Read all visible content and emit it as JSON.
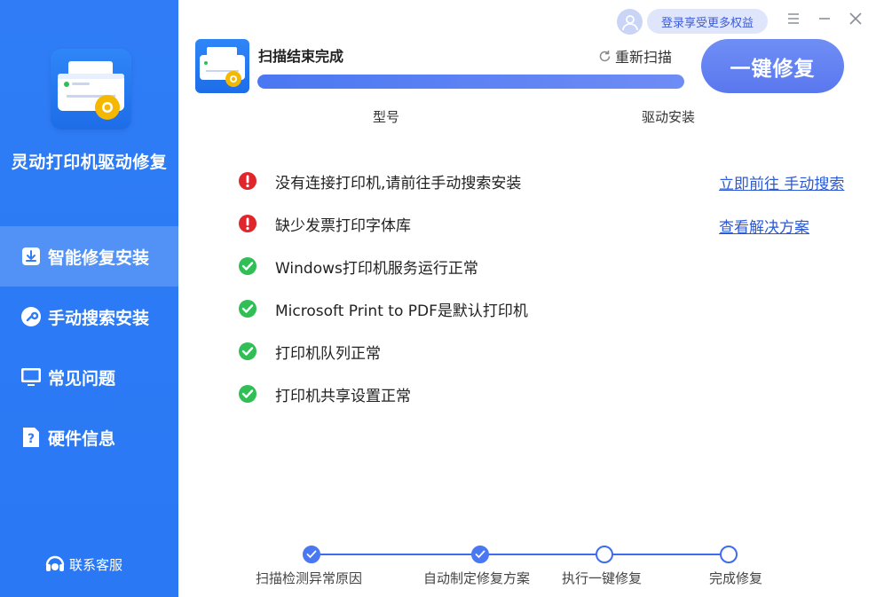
{
  "sidebar": {
    "app_title": "灵动打印机驱动修复",
    "items": [
      {
        "label": "智能修复安装",
        "icon": "download-icon",
        "active": true
      },
      {
        "label": "手动搜索安装",
        "icon": "wrench-icon",
        "active": false
      },
      {
        "label": "常见问题",
        "icon": "monitor-icon",
        "active": false
      },
      {
        "label": "硬件信息",
        "icon": "question-icon",
        "active": false
      }
    ],
    "support_label": "联系客服"
  },
  "topbar": {
    "login_label": "登录享受更多权益"
  },
  "scan": {
    "status": "扫描结束完成",
    "rescan_label": "重新扫描",
    "progress": 1.0,
    "model_label": "型号",
    "driver_label": "驱动安装",
    "fix_button": "一键修复"
  },
  "results": [
    {
      "status": "error",
      "text": "没有连接打印机,请前往手动搜索安装",
      "link": "立即前往 手动搜索"
    },
    {
      "status": "error",
      "text": "缺少发票打印字体库",
      "link": "查看解决方案"
    },
    {
      "status": "ok",
      "text": "Windows打印机服务运行正常"
    },
    {
      "status": "ok",
      "text": "Microsoft Print to PDF是默认打印机"
    },
    {
      "status": "ok",
      "text": "打印机队列正常"
    },
    {
      "status": "ok",
      "text": "打印机共享设置正常"
    }
  ],
  "steps": [
    {
      "label": "扫描检测异常原因",
      "done": true
    },
    {
      "label": "自动制定修复方案",
      "done": true
    },
    {
      "label": "执行一键修复",
      "done": false
    },
    {
      "label": "完成修复",
      "done": false
    }
  ],
  "colors": {
    "sidebar_bg": "#2f7cf6",
    "accent": "#4a78f2",
    "error": "#e0262b",
    "ok": "#2fbf55",
    "link": "#2c5ad6"
  }
}
